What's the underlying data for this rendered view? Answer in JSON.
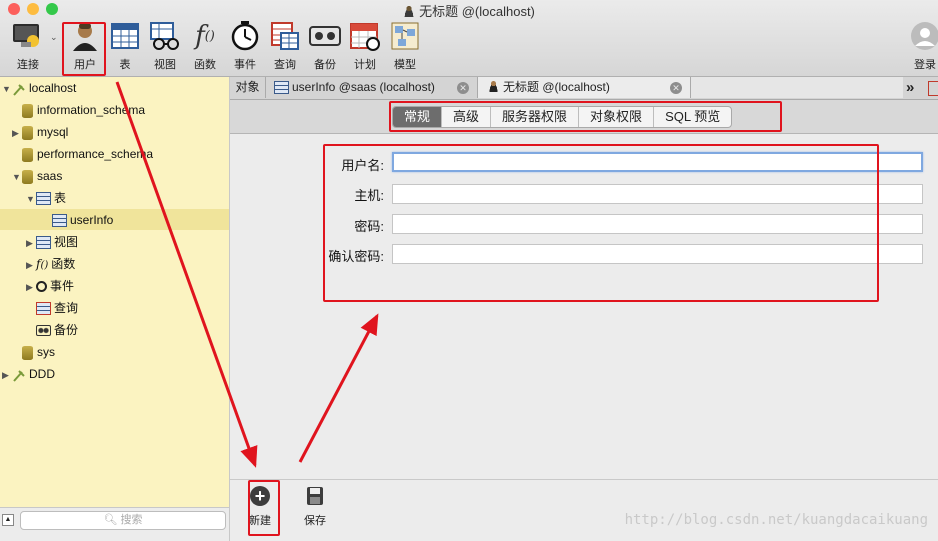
{
  "window": {
    "title": "无标题 @(localhost)"
  },
  "toolbar": {
    "items": [
      {
        "label": "连接",
        "icon": "connection-icon"
      },
      {
        "label": "用户",
        "icon": "user-icon"
      },
      {
        "label": "表",
        "icon": "table-icon"
      },
      {
        "label": "视图",
        "icon": "view-icon"
      },
      {
        "label": "函数",
        "icon": "function-icon"
      },
      {
        "label": "事件",
        "icon": "clock-icon"
      },
      {
        "label": "查询",
        "icon": "query-icon"
      },
      {
        "label": "备份",
        "icon": "backup-icon"
      },
      {
        "label": "计划",
        "icon": "schedule-icon"
      },
      {
        "label": "模型",
        "icon": "model-icon"
      }
    ],
    "login_label": "登录"
  },
  "sidebar": {
    "tree": [
      {
        "label": "localhost"
      },
      {
        "label": "information_schema"
      },
      {
        "label": "mysql"
      },
      {
        "label": "performance_schema"
      },
      {
        "label": "saas"
      },
      {
        "label": "表"
      },
      {
        "label": "userInfo"
      },
      {
        "label": "视图"
      },
      {
        "label": "函数"
      },
      {
        "label": "事件"
      },
      {
        "label": "查询"
      },
      {
        "label": "备份"
      },
      {
        "label": "sys"
      },
      {
        "label": "DDD"
      }
    ],
    "search_placeholder": "搜索"
  },
  "tabs": {
    "objects_label": "对象",
    "items": [
      {
        "label": "userInfo @saas (localhost)"
      },
      {
        "label": "无标题 @(localhost)"
      }
    ],
    "overflow": "»"
  },
  "segments": {
    "items": [
      "常规",
      "高级",
      "服务器权限",
      "对象权限",
      "SQL 预览"
    ],
    "active": "常规"
  },
  "form": {
    "username_label": "用户名:",
    "host_label": "主机:",
    "password_label": "密码:",
    "confirm_label": "确认密码:",
    "username_value": "",
    "host_value": "",
    "password_value": "",
    "confirm_value": ""
  },
  "bottom": {
    "new_label": "新建",
    "save_label": "保存"
  },
  "watermark": "http://blog.csdn.net/kuangdacaikuang",
  "colors": {
    "accent_red": "#e0141e",
    "sidebar_bg": "#fbf3c1",
    "active_segment": "#6d6d6d"
  }
}
